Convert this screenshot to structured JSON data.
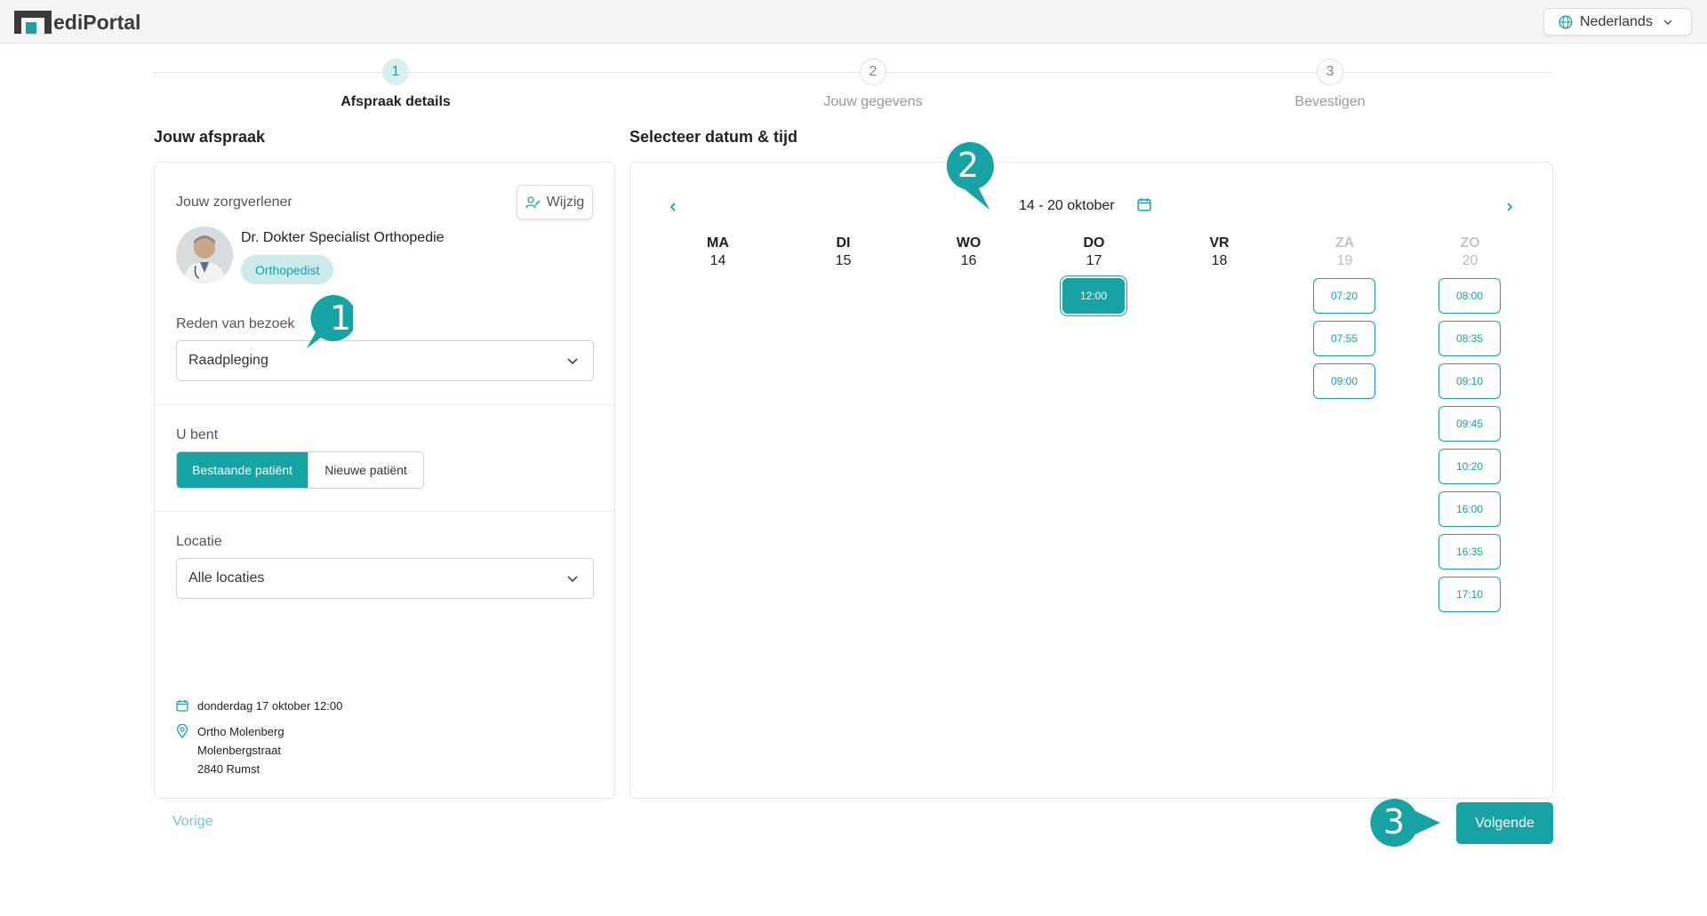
{
  "header": {
    "logo_part1": "ediPortal",
    "logo_accent": "",
    "language": "Nederlands"
  },
  "stepper": [
    {
      "num": "1",
      "label": "Afspraak details",
      "active": true
    },
    {
      "num": "2",
      "label": "Jouw gegevens",
      "active": false
    },
    {
      "num": "3",
      "label": "Bevestigen",
      "active": false
    }
  ],
  "left": {
    "title": "Jouw afspraak",
    "provider_label": "Jouw zorgverlener",
    "edit_label": "Wijzig",
    "doctor_name": "Dr. Dokter Specialist Orthopedie",
    "specialty": "Orthopedist",
    "reason_label": "Reden van bezoek",
    "reason_value": "Raadpleging",
    "patient_label": "U bent",
    "patient_options": [
      "Bestaande patiënt",
      "Nieuwe patiënt"
    ],
    "location_label": "Locatie",
    "location_value": "Alle locaties",
    "summary_date": "donderdag 17 oktober 12:00",
    "summary_loc_name": "Ortho Molenberg",
    "summary_street": "Molenbergstraat",
    "summary_city": "2840 Rumst"
  },
  "right": {
    "title": "Selecteer datum & tijd",
    "week": "14 - 20 oktober",
    "days": [
      {
        "name": "MA",
        "date": "14",
        "slots": []
      },
      {
        "name": "DI",
        "date": "15",
        "slots": []
      },
      {
        "name": "WO",
        "date": "16",
        "slots": []
      },
      {
        "name": "DO",
        "date": "17",
        "slots": [
          "12:00"
        ]
      },
      {
        "name": "VR",
        "date": "18",
        "slots": []
      },
      {
        "name": "ZA",
        "date": "19",
        "slots": [
          "07:20",
          "07:55",
          "09:00"
        ]
      },
      {
        "name": "ZO",
        "date": "20",
        "slots": [
          "08:00",
          "08:35",
          "09:10",
          "09:45",
          "10:20",
          "16:00",
          "16:35",
          "17:10"
        ]
      }
    ],
    "selected_slot": "12:00"
  },
  "footer": {
    "prev_label": "Vorige",
    "next_label": "Volgende"
  },
  "markers": [
    "1",
    "2",
    "3"
  ],
  "colors": {
    "accent": "#17a2a3",
    "accent_light": "#cdeaeb",
    "dark": "#3a3a3a"
  },
  "icons": [
    "globe-icon",
    "chevron-down-icon",
    "edit-user-icon",
    "calendar-icon",
    "location-pin-icon",
    "chevron-left-icon",
    "chevron-right-icon"
  ]
}
